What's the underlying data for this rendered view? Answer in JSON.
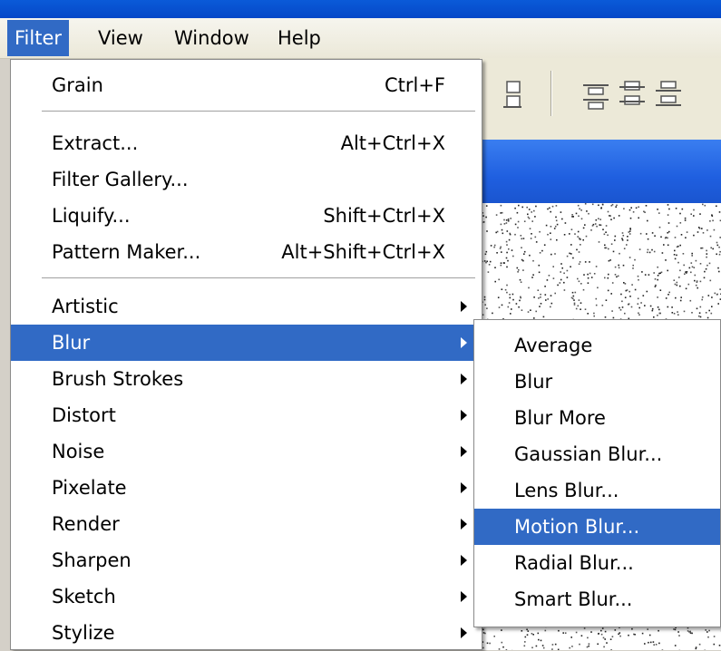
{
  "menubar": {
    "items": [
      {
        "label": "Filter",
        "active": true
      },
      {
        "label": "View",
        "active": false
      },
      {
        "label": "Window",
        "active": false
      },
      {
        "label": "Help",
        "active": false
      }
    ]
  },
  "filter_menu": {
    "items": [
      {
        "label": "Grain",
        "shortcut": "Ctrl+F"
      },
      {
        "label": "Extract...",
        "shortcut": "Alt+Ctrl+X"
      },
      {
        "label": "Filter Gallery...",
        "shortcut": ""
      },
      {
        "label": "Liquify...",
        "shortcut": "Shift+Ctrl+X"
      },
      {
        "label": "Pattern Maker...",
        "shortcut": "Alt+Shift+Ctrl+X"
      },
      {
        "label": "Artistic",
        "submenu": true
      },
      {
        "label": "Blur",
        "submenu": true,
        "highlighted": true
      },
      {
        "label": "Brush Strokes",
        "submenu": true
      },
      {
        "label": "Distort",
        "submenu": true
      },
      {
        "label": "Noise",
        "submenu": true
      },
      {
        "label": "Pixelate",
        "submenu": true
      },
      {
        "label": "Render",
        "submenu": true
      },
      {
        "label": "Sharpen",
        "submenu": true
      },
      {
        "label": "Sketch",
        "submenu": true
      },
      {
        "label": "Stylize",
        "submenu": true
      }
    ]
  },
  "blur_submenu": {
    "items": [
      {
        "label": "Average"
      },
      {
        "label": "Blur"
      },
      {
        "label": "Blur More"
      },
      {
        "label": "Gaussian Blur..."
      },
      {
        "label": "Lens Blur..."
      },
      {
        "label": "Motion Blur...",
        "highlighted": true
      },
      {
        "label": "Radial Blur..."
      },
      {
        "label": "Smart Blur..."
      }
    ]
  },
  "colors": {
    "highlight": "#316ac5",
    "titlebar": "#0a5ad8",
    "menubar": "#ece9d8"
  },
  "toolbar": {
    "icons": [
      "align-icon",
      "distribute-top-icon",
      "distribute-center-icon",
      "distribute-bottom-icon"
    ]
  }
}
